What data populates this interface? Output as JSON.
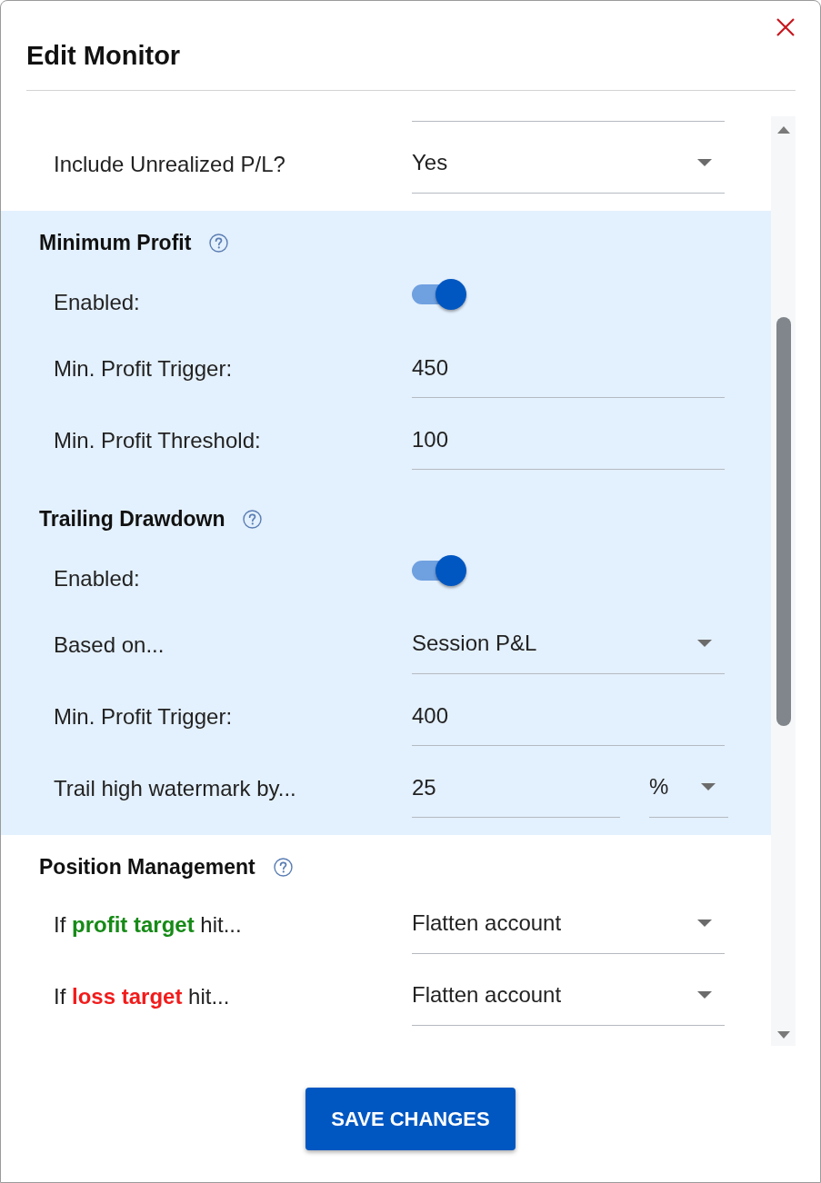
{
  "dialog": {
    "title": "Edit Monitor"
  },
  "sections": [
    {
      "fields": [
        {
          "kind": "select",
          "label": "Include Unrealized P/L?",
          "value": "Yes"
        }
      ]
    },
    {
      "title": "Minimum Profit",
      "highlighted": true,
      "fields": [
        {
          "kind": "toggle",
          "label": "Enabled:",
          "on": true
        },
        {
          "kind": "text",
          "label": "Min. Profit Trigger:",
          "value": "450"
        },
        {
          "kind": "text",
          "label": "Min. Profit Threshold:",
          "value": "100"
        }
      ]
    },
    {
      "title": "Trailing Drawdown",
      "highlighted": true,
      "fields": [
        {
          "kind": "toggle",
          "label": "Enabled:",
          "on": true
        },
        {
          "kind": "select",
          "label": "Based on...",
          "value": "Session P&L"
        },
        {
          "kind": "text",
          "label": "Min. Profit Trigger:",
          "value": "400"
        },
        {
          "kind": "text_unit",
          "label": "Trail high watermark by...",
          "value": "25",
          "unit": "%"
        }
      ]
    },
    {
      "title": "Position Management",
      "fields": [
        {
          "kind": "select",
          "label": "If **profit target** hit...",
          "color": "#168a16",
          "value": "Flatten account"
        },
        {
          "kind": "select",
          "label": "If **loss target** hit...",
          "color": "#f21b1b",
          "value": "Flatten account"
        }
      ]
    }
  ],
  "save_button": "SAVE CHANGES"
}
